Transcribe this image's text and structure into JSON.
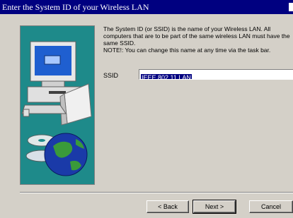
{
  "window": {
    "title": "Enter the System ID of your Wireless LAN"
  },
  "main": {
    "description": "The System ID (or SSID) is the name of your Wireless LAN.  All computers that are to be part of the same wireless LAN must have the same SSID.\nNOTE!: You can change this name at any time via the task bar.",
    "ssid_label": "SSID",
    "ssid_value": "IEEE 802.11 LAN"
  },
  "buttons": {
    "back": "< Back",
    "next": "Next >",
    "cancel": "Cancel"
  },
  "colors": {
    "titlebar": "#000080",
    "artwork_bg": "#1e8a8a",
    "dialog_bg": "#d4d0c8",
    "selection": "#000080"
  },
  "icons": {
    "artwork": "computer-and-globe-icon"
  }
}
